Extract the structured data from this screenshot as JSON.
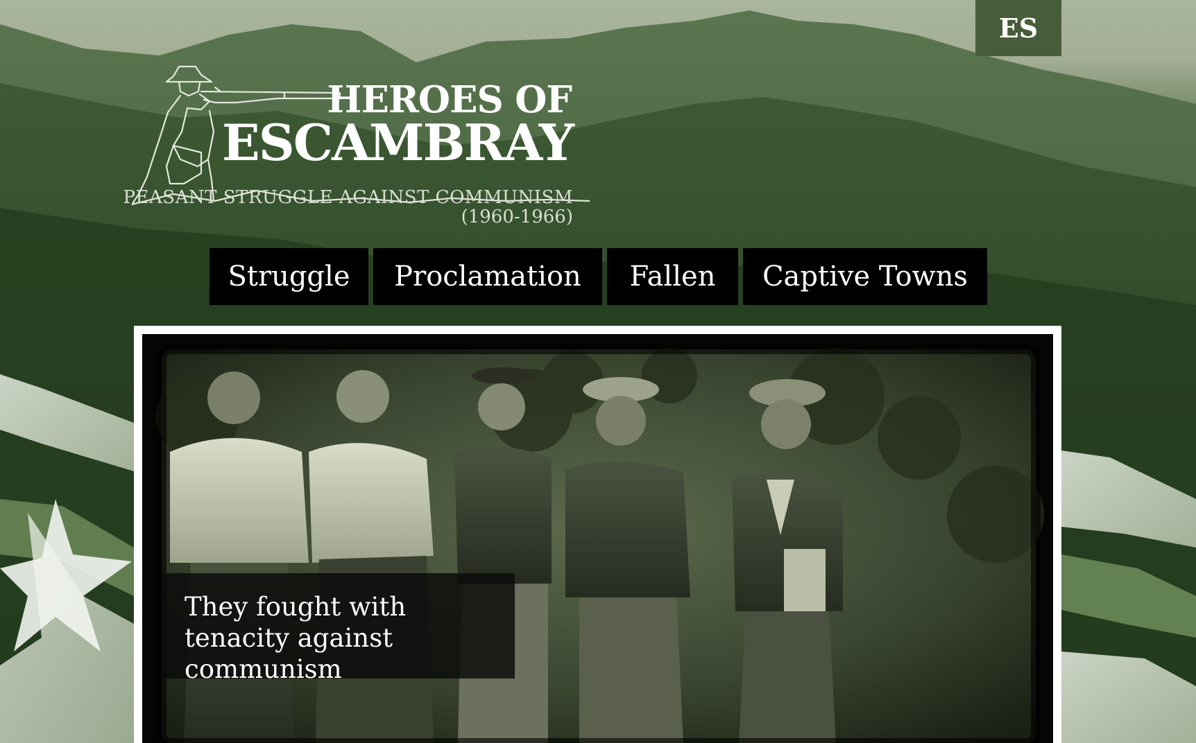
{
  "language_toggle": {
    "label": "ES"
  },
  "logo": {
    "title_line1": "HEROES OF",
    "title_line2": "ESCAMBRAY",
    "subtitle": "PEASANT STRUGGLE AGAINST COMMUNISM",
    "years": "(1960-1966)",
    "emblem_icon": "rifleman-silhouette-icon"
  },
  "nav": {
    "items": [
      {
        "label": "Struggle"
      },
      {
        "label": "Proclamation"
      },
      {
        "label": "Fallen"
      },
      {
        "label": "Captive Towns"
      }
    ]
  },
  "hero": {
    "caption": "They fought with tenacity against communism",
    "image": "black-and-white photo of five guerrilla fighters"
  },
  "colors": {
    "sky": "#a3ae95",
    "mountain_dark": "#1f361a",
    "lang_button": "#475d39",
    "nav_background": "#000000",
    "text": "#ffffff"
  }
}
